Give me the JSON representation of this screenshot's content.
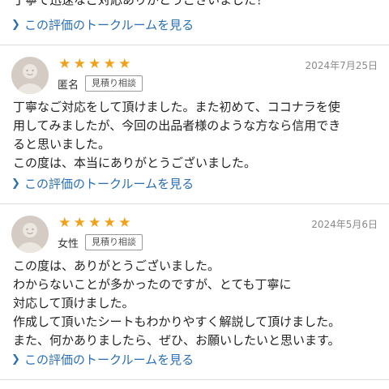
{
  "top": {
    "cut_text": "丁寧で迅速なご対応ありがとうございました！",
    "link_label": "この評価のトークルームを見る"
  },
  "reviews": [
    {
      "rating": 5,
      "date": "2024年7月25日",
      "user": "匿名",
      "tag": "見積り相談",
      "lines": [
        "丁寧なご対応をして頂けました。また初めて、ココナラを使",
        "用してみましたが、今回の出品者様のような方なら信用でき",
        "ると思いました。",
        "この度は、本当にありがとうございました。"
      ],
      "link_label": "この評価のトークルームを見る"
    },
    {
      "rating": 5,
      "date": "2024年5月6日",
      "user": "女性",
      "tag": "見積り相談",
      "lines": [
        "この度は、ありがとうございました。",
        "わからないことが多かったのですが、とても丁寧に",
        "対応して頂けました。",
        "作成して頂いたシートもわかりやすく解説して頂けました。",
        "また、何かありましたら、ぜひ、お願いしたいと思います。"
      ],
      "link_label": "この評価のトークルームを見る"
    }
  ],
  "icons": {
    "star": "star-icon",
    "chevron": "chevron-right-icon",
    "avatar": "avatar-icon"
  },
  "colors": {
    "link": "#2a6fb5",
    "star": "#f0a11c",
    "avatar_bg": "#d4ccc4",
    "divider": "#dcdcdc"
  }
}
